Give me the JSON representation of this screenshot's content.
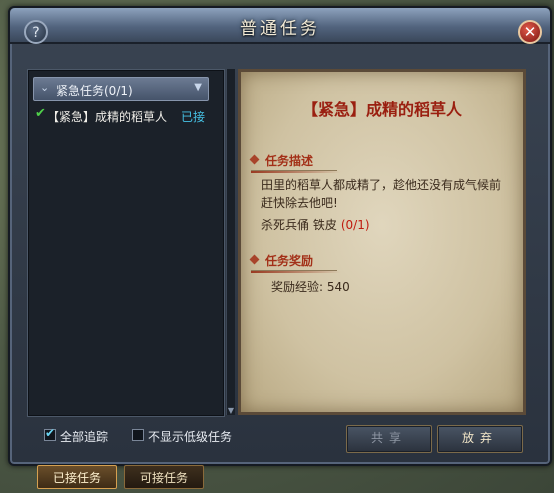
{
  "window": {
    "title": "普通任务"
  },
  "quest_list": {
    "category": {
      "label": "紧急任务(0/1)"
    },
    "items": [
      {
        "name": "【紧急】成精的稻草人",
        "status": "已接"
      }
    ]
  },
  "detail": {
    "title": "【紧急】成精的稻草人",
    "description_header": "任务描述",
    "description": "田里的稻草人都成精了，趁他还没有成气候前赶快除去他吧!",
    "objective_text": "杀死兵俑 铁皮",
    "objective_count": "(0/1)",
    "reward_header": "任务奖励",
    "reward_text": "奖励经验: 540"
  },
  "options": {
    "track_all": {
      "label": "全部追踪",
      "checked": true
    },
    "hide_low": {
      "label": "不显示低级任务",
      "checked": false
    }
  },
  "buttons": {
    "share": "共享",
    "abandon": "放弃"
  },
  "tabs": {
    "accepted": "已接任务",
    "available": "可接任务"
  },
  "icons": {
    "help": "?",
    "close": "✕"
  }
}
